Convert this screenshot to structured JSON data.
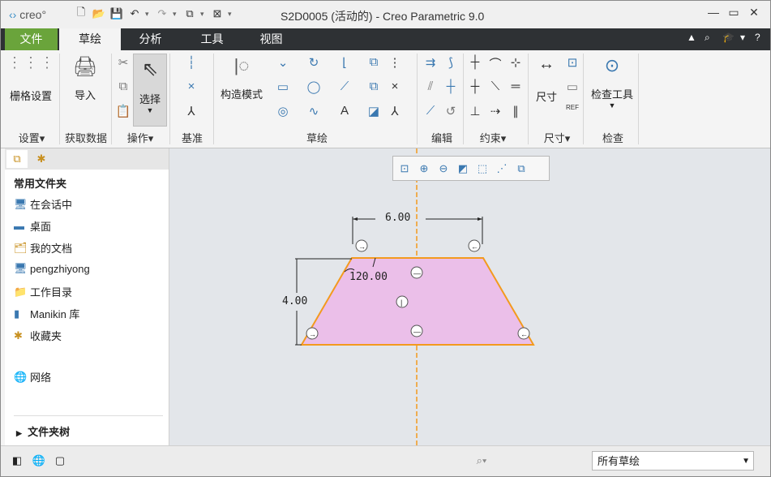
{
  "titlebar": {
    "logo_prefix": "‹›",
    "logo_text": "creo°",
    "title": "S2D0005 (活动的) - Creo Parametric 9.0"
  },
  "menu": {
    "tabs": [
      {
        "label": "文件"
      },
      {
        "label": "草绘"
      },
      {
        "label": "分析"
      },
      {
        "label": "工具"
      },
      {
        "label": "视图"
      }
    ]
  },
  "ribbon": {
    "grid_settings": "栅格设置",
    "import": "导入",
    "select": "选择",
    "construction_mode": "构造模式",
    "dimension": "尺寸",
    "inspect_tool": "检查工具",
    "ref_label": "REF",
    "groups": {
      "settings": "设置▾",
      "get_data": "获取数据",
      "operations": "操作▾",
      "datum": "基准",
      "sketch": "草绘",
      "edit": "编辑",
      "constraints": "约束▾",
      "dimension": "尺寸▾",
      "inspect": "检查"
    }
  },
  "panel": {
    "favorites_title": "常用文件夹",
    "items": [
      {
        "label": "在会话中"
      },
      {
        "label": "桌面"
      },
      {
        "label": "我的文档"
      },
      {
        "label": "pengzhiyong"
      },
      {
        "label": "工作目录"
      },
      {
        "label": "Manikin 库"
      },
      {
        "label": "收藏夹"
      },
      {
        "label": "网络"
      }
    ],
    "folder_tree": "文件夹树"
  },
  "sketch": {
    "dim_width": "6.00",
    "dim_height": "4.00",
    "dim_angle": "120.00",
    "fill_color": "#ebbfe9",
    "edge_color": "#f39a1e",
    "centerline_color": "#f39a1e"
  },
  "statusbar": {
    "filter_value": "所有草绘"
  },
  "colors": {
    "accent_file_tab": "#6aa43b",
    "menubar": "#2e3134"
  }
}
